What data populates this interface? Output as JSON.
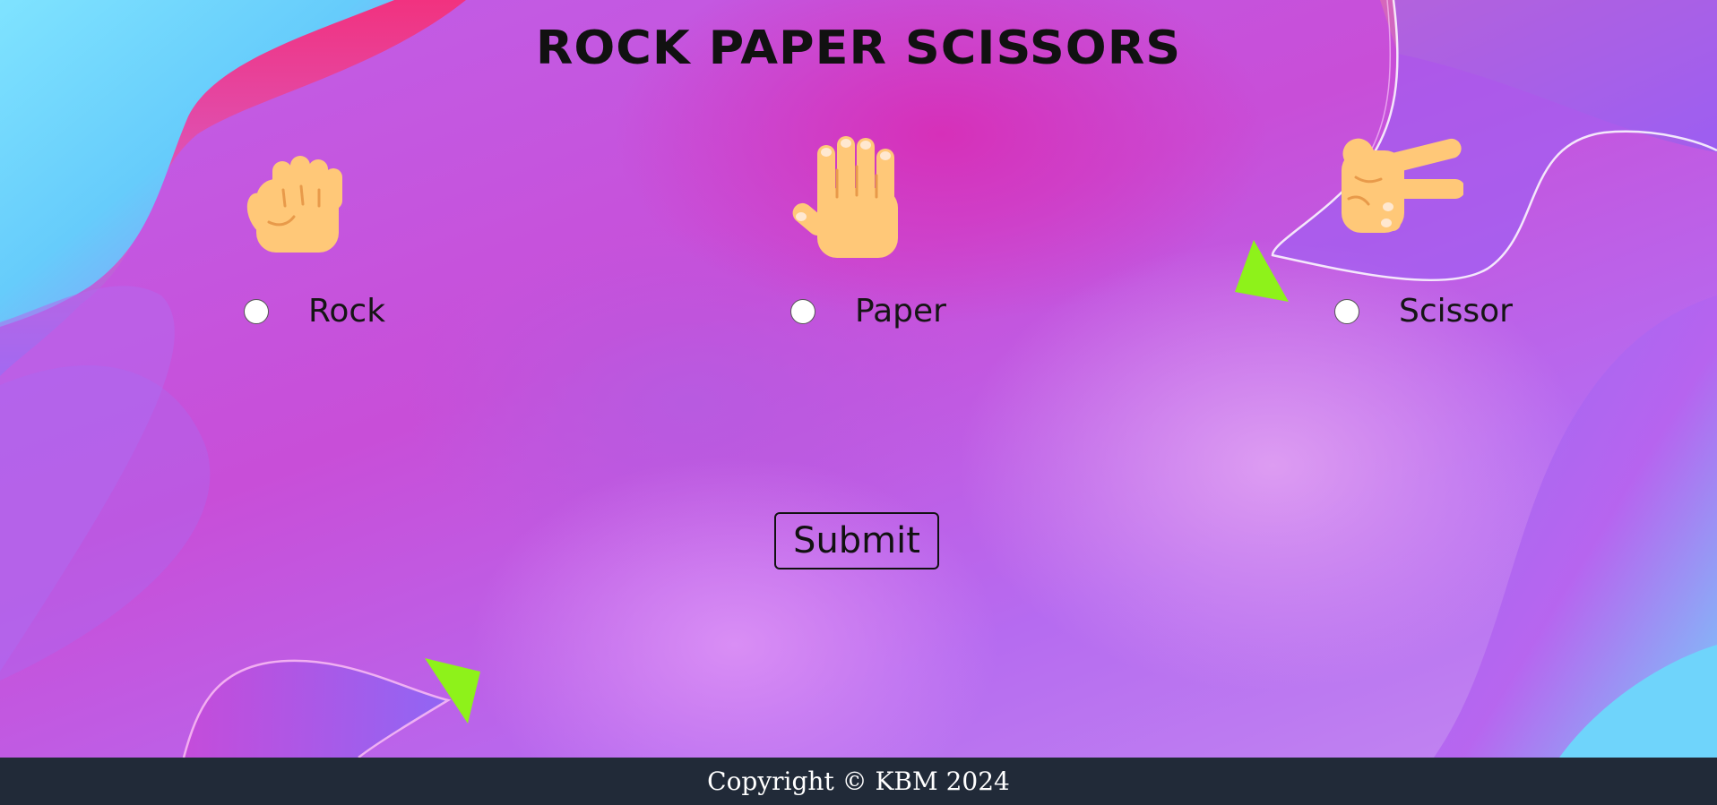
{
  "page": {
    "title": "ROCK PAPER SCISSORS"
  },
  "choices": [
    {
      "label": "Rock",
      "icon": "fist-hand-icon"
    },
    {
      "label": "Paper",
      "icon": "open-hand-icon"
    },
    {
      "label": "Scissor",
      "icon": "victory-hand-icon"
    }
  ],
  "form": {
    "submit_label": "Submit"
  },
  "footer": {
    "copyright": "Copyright © KBM 2024"
  },
  "colors": {
    "skin": "#ffc878",
    "accent_green": "#8ef21a",
    "footer_bg": "#212a38",
    "cyan": "#6fd4fb",
    "hot_pink": "#f4307a"
  }
}
